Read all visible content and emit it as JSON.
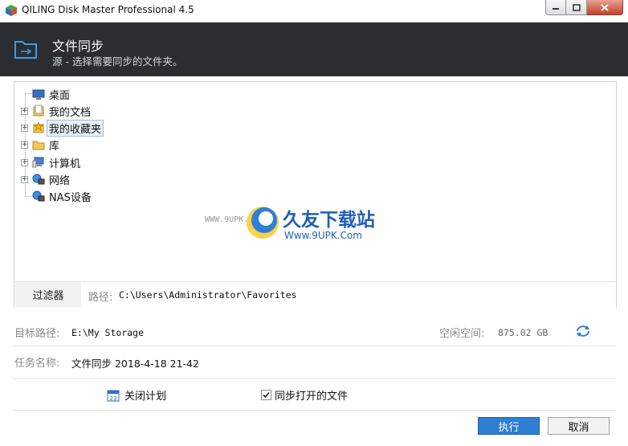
{
  "window": {
    "title": "QILING Disk Master Professional 4.5"
  },
  "header": {
    "title": "文件同步",
    "subtitle": "源 - 选择需要同步的文件夹。"
  },
  "tree": {
    "items": [
      {
        "label": "桌面",
        "icon": "desktop-icon",
        "expandable": false
      },
      {
        "label": "我的文档",
        "icon": "documents-icon",
        "expandable": true
      },
      {
        "label": "我的收藏夹",
        "icon": "favorites-icon",
        "expandable": true,
        "selected": true
      },
      {
        "label": "库",
        "icon": "library-icon",
        "expandable": true
      },
      {
        "label": "计算机",
        "icon": "computer-icon",
        "expandable": true
      },
      {
        "label": "网络",
        "icon": "network-icon",
        "expandable": true
      },
      {
        "label": "NAS设备",
        "icon": "nas-icon",
        "expandable": false
      }
    ]
  },
  "watermark": {
    "site": "WWW.9UPK.COM",
    "brand": "久友下载站",
    "url": "Www.9UPK.Com"
  },
  "filter": {
    "tab_label": "过滤器",
    "path_label": "路径:",
    "path_value": "C:\\Users\\Administrator\\Favorites"
  },
  "target": {
    "label": "目标路径:",
    "value": "E:\\My Storage",
    "free_label": "空闲空间:",
    "free_value": "875.02 GB"
  },
  "task": {
    "label": "任务名称:",
    "value": "文件同步 2018-4-18 21-42"
  },
  "options": {
    "schedule_label": "关闭计划",
    "sync_open_label": "同步打开的文件",
    "sync_open_checked": true
  },
  "buttons": {
    "execute": "执行",
    "cancel": "取消"
  },
  "colors": {
    "header_bg": "#2b2d31",
    "accent": "#2f7fd4"
  }
}
